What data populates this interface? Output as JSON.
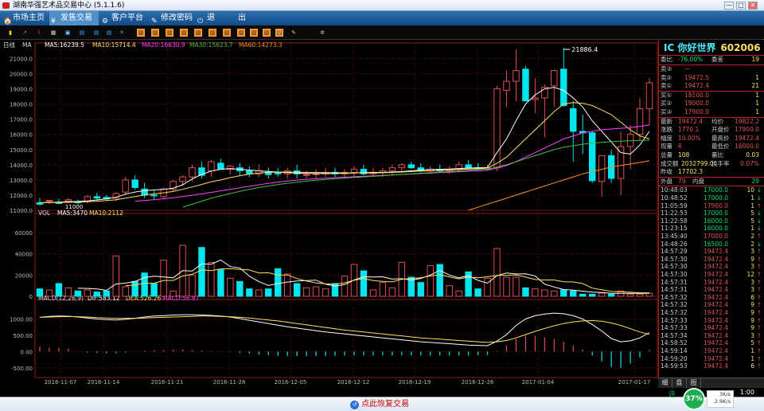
{
  "window": {
    "title": "湖南华强艺术品交易中心 (5.1.1.6)",
    "min": "—",
    "max": "□",
    "close": "✕"
  },
  "menu": [
    {
      "label": "市场主页",
      "icon": "🏠"
    },
    {
      "label": "发售交易",
      "icon": "¥"
    },
    {
      "label": "客户平台",
      "icon": "⚙"
    },
    {
      "label": "修改密码",
      "icon": "✎"
    },
    {
      "label": "退",
      "icon": "⏻"
    },
    {
      "label": "出",
      "icon": ""
    }
  ],
  "toolbar_icons": [
    "bar-chart",
    "line-chart",
    "k-line",
    "grid",
    "window",
    "doc-1",
    "doc-2",
    "doc-3",
    "close-doc",
    "layout-1",
    "layout-2",
    "layout-3",
    "layout-4",
    "layout-5",
    "layout-6",
    "layout-7",
    "layout-8",
    "layout-9",
    "layout-10",
    "layout-11",
    "search",
    "pen",
    "settings"
  ],
  "colors": {
    "up": "#e05050",
    "down": "#00e5ee",
    "ma5": "#ffffff",
    "ma10": "#ffe060",
    "ma20": "#ff40ff",
    "ma30": "#40c040",
    "ma60": "#ff9020",
    "volbar_up": "#e05050",
    "volbar_down": "#00e5ee",
    "accent": "#4ef0ff"
  },
  "kline": {
    "header": {
      "period": "日线",
      "adj": "MA",
      "ma5": "MA5:16239.5",
      "ma10": "MA10:15714.4",
      "ma20": "MA20:16630.9",
      "ma30": "MA30:15623.7",
      "ma60": "MA60:14273.3"
    },
    "ylim": [
      11000,
      21600
    ],
    "yticks": [
      "21000.0",
      "20000.0",
      "19000.0",
      "18000.0",
      "17000.0",
      "16000.0",
      "15000.0",
      "14000.0",
      "13000.0",
      "12000.0",
      "11000.0"
    ],
    "ytick_values": [
      21000,
      20000,
      19000,
      18000,
      17000,
      16000,
      15000,
      14000,
      13000,
      12000,
      11000
    ],
    "peak_label": "21886.4",
    "low_label": "11000"
  },
  "volume": {
    "header": {
      "name": "VOL",
      "ma5": "MA5:3470",
      "ma10": "MA10:2112"
    },
    "ylim": [
      0,
      75000
    ],
    "yticks": [
      "60000",
      "40000",
      "20000",
      "0"
    ],
    "ytick_values": [
      60000,
      40000,
      20000,
      0
    ]
  },
  "macd": {
    "header": {
      "name": "MACD(12,26,9)",
      "dif": "DIF:583.12",
      "dea": "DEA:526.26",
      "macd": "MACD:56.87"
    },
    "ylim": [
      -700,
      1500
    ],
    "yticks": [
      "1000.00",
      "500.00",
      "0.00",
      "-500.00"
    ],
    "ytick_values": [
      1000,
      500,
      0,
      -500
    ]
  },
  "xaxis": {
    "labels": [
      "2016-11-07",
      "2016-11-14",
      "2016-11-21",
      "2016-11-28",
      "2016-12-05",
      "2016-12-12",
      "2016-12-19",
      "2016-12-26",
      "2017-01-04",
      "2017-01-17"
    ]
  },
  "chart_data": {
    "type": "candlestick",
    "candles": [
      [
        11500,
        11800,
        11300,
        11400
      ],
      [
        11600,
        11700,
        11400,
        11650
      ],
      [
        11500,
        11750,
        11400,
        11450
      ],
      [
        11600,
        11800,
        11450,
        11700
      ],
      [
        11550,
        11700,
        11400,
        11500
      ],
      [
        11600,
        12000,
        11450,
        11900
      ],
      [
        11900,
        12150,
        11700,
        11800
      ],
      [
        11850,
        12000,
        11650,
        11750
      ],
      [
        11800,
        12200,
        11600,
        12100
      ],
      [
        12200,
        13200,
        12000,
        13000
      ],
      [
        13000,
        13300,
        12350,
        12500
      ],
      [
        12400,
        12800,
        11800,
        12000
      ],
      [
        12000,
        12300,
        11700,
        11950
      ],
      [
        11900,
        12500,
        11800,
        12400
      ],
      [
        12400,
        13000,
        12200,
        12900
      ],
      [
        12900,
        13300,
        12600,
        13200
      ],
      [
        13200,
        14000,
        12900,
        13800
      ],
      [
        13800,
        14200,
        13100,
        13300
      ],
      [
        13600,
        14300,
        13200,
        14200
      ],
      [
        14100,
        14400,
        13700,
        13700
      ],
      [
        13700,
        14000,
        13400,
        13900
      ],
      [
        13800,
        14100,
        13300,
        13600
      ],
      [
        13600,
        13900,
        13200,
        13400
      ],
      [
        13400,
        14000,
        13200,
        13600
      ],
      [
        13500,
        13800,
        13100,
        13350
      ],
      [
        13500,
        13800,
        13200,
        13400
      ],
      [
        13400,
        13800,
        13100,
        13600
      ],
      [
        13600,
        14000,
        13100,
        13400
      ],
      [
        13300,
        13600,
        13100,
        13350
      ],
      [
        13400,
        13700,
        13100,
        13400
      ],
      [
        13400,
        13800,
        13200,
        13500
      ],
      [
        13500,
        13800,
        13200,
        13400
      ],
      [
        13400,
        13700,
        13100,
        13500
      ],
      [
        13500,
        13900,
        13200,
        13700
      ],
      [
        13700,
        14000,
        13300,
        13400
      ],
      [
        13400,
        13800,
        13200,
        13500
      ],
      [
        13500,
        13800,
        13200,
        13600
      ],
      [
        13600,
        14000,
        13300,
        13800
      ],
      [
        13800,
        14100,
        13500,
        14000
      ],
      [
        14000,
        14200,
        13700,
        13800
      ],
      [
        13800,
        14100,
        13500,
        13600
      ],
      [
        13600,
        13900,
        13400,
        13700
      ],
      [
        13700,
        14000,
        13500,
        13600
      ],
      [
        13600,
        13900,
        13400,
        13700
      ],
      [
        13700,
        14200,
        13500,
        14000
      ],
      [
        14000,
        14300,
        13700,
        13800
      ],
      [
        13800,
        14100,
        13600,
        13700
      ],
      [
        13700,
        14000,
        13600,
        13800
      ],
      [
        13800,
        19200,
        13600,
        19000
      ],
      [
        18900,
        20200,
        17800,
        19500
      ],
      [
        19500,
        21600,
        18200,
        20200
      ],
      [
        20300,
        20500,
        18200,
        18200
      ],
      [
        18300,
        19700,
        17400,
        18400
      ],
      [
        18400,
        19300,
        15800,
        19100
      ],
      [
        19200,
        20300,
        17800,
        20200
      ],
      [
        20300,
        21700,
        17800,
        17900
      ],
      [
        17700,
        18200,
        14200,
        16200
      ],
      [
        16200,
        17300,
        14700,
        16100
      ],
      [
        16100,
        16200,
        12800,
        12950
      ],
      [
        12900,
        13300,
        11900,
        14600
      ],
      [
        14600,
        15000,
        12800,
        13100
      ],
      [
        13100,
        16200,
        12000,
        15200
      ],
      [
        15200,
        16600,
        13700,
        16000
      ],
      [
        16000,
        18400,
        15600,
        17700
      ],
      [
        17700,
        19700,
        16600,
        19400
      ]
    ],
    "ma5": [
      11500,
      11520,
      11540,
      11560,
      11580,
      11620,
      11680,
      11760,
      11860,
      12060,
      12200,
      12300,
      12340,
      12380,
      12460,
      12680,
      13060,
      13360,
      13580,
      13700,
      13750,
      13700,
      13650,
      13600,
      13560,
      13520,
      13480,
      13450,
      13430,
      13420,
      13420,
      13430,
      13440,
      13460,
      13480,
      13490,
      13500,
      13520,
      13550,
      13600,
      13650,
      13680,
      13700,
      13720,
      13750,
      13780,
      13800,
      13820,
      14800,
      15700,
      16900,
      18000,
      18600,
      19000,
      19100,
      18900,
      18400,
      17800,
      16900,
      16200,
      15500,
      14800,
      14700,
      15300,
      16200
    ],
    "ma10": [
      11500,
      11510,
      11520,
      11530,
      11540,
      11560,
      11600,
      11640,
      11700,
      11800,
      11900,
      12000,
      12080,
      12150,
      12250,
      12380,
      12540,
      12700,
      12880,
      13000,
      13150,
      13280,
      13380,
      13450,
      13500,
      13520,
      13520,
      13510,
      13500,
      13490,
      13480,
      13470,
      13460,
      13460,
      13460,
      13460,
      13470,
      13490,
      13520,
      13550,
      13580,
      13600,
      13630,
      13660,
      13690,
      13720,
      13750,
      13780,
      14100,
      14500,
      15100,
      15700,
      16300,
      16900,
      17500,
      18000,
      18100,
      18050,
      17900,
      17600,
      17300,
      16800,
      16300,
      15900,
      15700
    ],
    "ma20": [
      null,
      null,
      null,
      null,
      null,
      null,
      null,
      null,
      null,
      null,
      11600,
      11650,
      11700,
      11760,
      11830,
      11900,
      11990,
      12080,
      12180,
      12280,
      12380,
      12480,
      12580,
      12680,
      12780,
      12860,
      12930,
      12990,
      13040,
      13080,
      13120,
      13150,
      13180,
      13210,
      13240,
      13270,
      13300,
      13330,
      13360,
      13390,
      13420,
      13450,
      13480,
      13510,
      13540,
      13570,
      13600,
      13640,
      13780,
      13950,
      14200,
      14500,
      14800,
      15100,
      15400,
      15700,
      15900,
      16100,
      16200,
      16300,
      16350,
      16400,
      16450,
      16520,
      16630
    ],
    "ma30": [
      null,
      null,
      null,
      null,
      null,
      null,
      null,
      null,
      null,
      null,
      null,
      null,
      null,
      null,
      null,
      11200,
      11400,
      11600,
      11800,
      11950,
      12100,
      12250,
      12380,
      12500,
      12600,
      12700,
      12780,
      12850,
      12920,
      12980,
      13030,
      13080,
      13120,
      13160,
      13200,
      13240,
      13280,
      13320,
      13360,
      13400,
      13440,
      13480,
      13520,
      13560,
      13600,
      13640,
      13680,
      13720,
      13850,
      14000,
      14200,
      14400,
      14600,
      14800,
      15000,
      15150,
      15250,
      15350,
      15420,
      15480,
      15520,
      15560,
      15580,
      15600,
      15620
    ],
    "ma60": [
      null,
      null,
      null,
      null,
      null,
      null,
      null,
      null,
      null,
      null,
      null,
      null,
      null,
      null,
      null,
      null,
      null,
      null,
      null,
      null,
      null,
      null,
      null,
      null,
      null,
      null,
      null,
      null,
      null,
      null,
      null,
      null,
      null,
      null,
      null,
      null,
      null,
      null,
      null,
      null,
      null,
      null,
      null,
      null,
      null,
      11000,
      11200,
      11400,
      11600,
      11800,
      12000,
      12200,
      12400,
      12600,
      12800,
      13000,
      13200,
      13400,
      13550,
      13700,
      13850,
      13950,
      14050,
      14150,
      14270
    ],
    "volume": [
      7000,
      6000,
      12000,
      8000,
      5000,
      6000,
      4000,
      5000,
      38000,
      9000,
      14000,
      22000,
      12000,
      34000,
      5000,
      48000,
      20000,
      46000,
      32000,
      25000,
      17000,
      14000,
      7000,
      6000,
      7000,
      26000,
      21000,
      12000,
      8000,
      9000,
      7000,
      12000,
      19000,
      30000,
      24000,
      6000,
      13000,
      8000,
      32000,
      18000,
      13000,
      29000,
      30000,
      10000,
      5000,
      23000,
      7000,
      17000,
      45000,
      18000,
      18000,
      8000,
      7000,
      6000,
      5000,
      6000,
      5000,
      2000,
      2000,
      3000,
      2000,
      5000,
      2000,
      2000,
      3000
    ],
    "dif": [
      1050,
      1080,
      1090,
      1085,
      1060,
      1030,
      1000,
      980,
      970,
      990,
      1020,
      1060,
      1090,
      1100,
      1120,
      1130,
      1130,
      1120,
      1110,
      1090,
      1060,
      1010,
      960,
      910,
      860,
      810,
      760,
      720,
      680,
      640,
      600,
      570,
      540,
      510,
      480,
      450,
      420,
      390,
      360,
      330,
      300,
      280,
      260,
      240,
      220,
      200,
      190,
      180,
      320,
      520,
      800,
      1000,
      1100,
      1150,
      1180,
      1160,
      1100,
      1000,
      830,
      630,
      400,
      300,
      330,
      420,
      583
    ],
    "dea": [
      1050,
      1060,
      1070,
      1075,
      1070,
      1060,
      1040,
      1030,
      1020,
      1020,
      1020,
      1030,
      1040,
      1050,
      1060,
      1070,
      1080,
      1090,
      1090,
      1080,
      1070,
      1050,
      1030,
      1000,
      970,
      940,
      900,
      860,
      820,
      780,
      740,
      700,
      660,
      630,
      600,
      570,
      540,
      510,
      480,
      450,
      420,
      400,
      380,
      360,
      340,
      320,
      300,
      280,
      300,
      340,
      420,
      520,
      620,
      710,
      790,
      860,
      910,
      940,
      950,
      930,
      880,
      800,
      700,
      600,
      526
    ],
    "macd": [
      150,
      120,
      110,
      95,
      0,
      -30,
      -40,
      -50,
      -50,
      -30,
      0,
      30,
      50,
      50,
      60,
      60,
      50,
      30,
      20,
      10,
      -10,
      -40,
      -70,
      -90,
      -110,
      -130,
      -140,
      -140,
      -140,
      -140,
      -140,
      -130,
      -120,
      -120,
      -120,
      -120,
      -120,
      -120,
      -120,
      -120,
      -120,
      -120,
      -120,
      -120,
      -120,
      -120,
      -110,
      -100,
      20,
      180,
      380,
      480,
      480,
      440,
      390,
      300,
      190,
      60,
      -120,
      -300,
      -480,
      -500,
      -370,
      -180,
      57
    ]
  },
  "quote": {
    "code": "IC 你好世界",
    "id": "602006",
    "ratio": {
      "label": "委比",
      "value": "-76.00%",
      "label2": "委差",
      "value2": "19"
    },
    "sell": [
      {
        "label": "卖③",
        "price": "—",
        "qty": ""
      },
      {
        "label": "卖②",
        "price": "19472.5",
        "qty": "1"
      },
      {
        "label": "卖①",
        "price": "19472.4",
        "qty": "21"
      }
    ],
    "buy": [
      {
        "label": "买①",
        "price": "18100.0",
        "qty": "1"
      },
      {
        "label": "买②",
        "price": "18000.0",
        "qty": "1"
      },
      {
        "label": "买③",
        "price": "17900.0",
        "qty": "1"
      }
    ],
    "stats": [
      {
        "l1": "最新",
        "v1": "19472.4",
        "l2": "均价",
        "v2": "19822.2"
      },
      {
        "l1": "涨跌",
        "v1": "1770.1",
        "l2": "开盘价",
        "v2": "17900.0"
      },
      {
        "l1": "幅度",
        "v1": "10.00%",
        "l2": "最高价",
        "v2": "19472.4"
      },
      {
        "l1": "现量",
        "v1": "6",
        "l2": "最低价",
        "v2": "16000.0"
      },
      {
        "l1": "总量",
        "v1": "108",
        "l2": "量比",
        "v2": "0.03"
      },
      {
        "l1": "成交额",
        "v1": "2032799.0",
        "l2": "换手率",
        "v2": "0.07%"
      },
      {
        "l1": "昨收",
        "v1": "17702.3",
        "l2": "",
        "v2": ""
      }
    ],
    "outer": {
      "label": "外盘",
      "value": "79",
      "label2": "内盘",
      "value2": "29"
    },
    "ticks": [
      {
        "t": "10:48:03",
        "p": "17000.0",
        "q": "10",
        "d": "↓",
        "c": "down"
      },
      {
        "t": "10:48:52",
        "p": "17000.0",
        "q": "1",
        "d": "↓",
        "c": "down"
      },
      {
        "t": "11:05:59",
        "p": "17900.0",
        "q": "1",
        "d": "↑",
        "c": "up"
      },
      {
        "t": "11:22:53",
        "p": "17000.0",
        "q": "5",
        "d": "↓",
        "c": "down"
      },
      {
        "t": "11:22:58",
        "p": "16000.0",
        "q": "5",
        "d": "↓",
        "c": "down"
      },
      {
        "t": "11:23:15",
        "p": "16000.0",
        "q": "1",
        "d": "↓",
        "c": "down"
      },
      {
        "t": "13:45:40",
        "p": "17000.0",
        "q": "2",
        "d": "↑",
        "c": "up"
      },
      {
        "t": "14:48:26",
        "p": "16500.0",
        "q": "2",
        "d": "↓",
        "c": "down"
      },
      {
        "t": "14:57:29",
        "p": "19472.4",
        "q": "3",
        "d": "↑",
        "c": "up"
      },
      {
        "t": "14:57:30",
        "p": "19472.4",
        "q": "9",
        "d": "↑",
        "c": "up"
      },
      {
        "t": "14:57:30",
        "p": "19472.4",
        "q": "3",
        "d": "↑",
        "c": "up"
      },
      {
        "t": "14:57:30",
        "p": "19472.4",
        "q": "12",
        "d": "↑",
        "c": "up"
      },
      {
        "t": "14:57:31",
        "p": "19472.4",
        "q": "3",
        "d": "↑",
        "c": "up"
      },
      {
        "t": "14:57:31",
        "p": "19472.4",
        "q": "3",
        "d": "↑",
        "c": "up"
      },
      {
        "t": "14:57:32",
        "p": "19472.4",
        "q": "6",
        "d": "↑",
        "c": "up"
      },
      {
        "t": "14:57:32",
        "p": "19472.4",
        "q": "9",
        "d": "↑",
        "c": "up"
      },
      {
        "t": "14:57:32",
        "p": "19472.4",
        "q": "9",
        "d": "↑",
        "c": "up"
      },
      {
        "t": "14:57:33",
        "p": "19472.4",
        "q": "9",
        "d": "↑",
        "c": "up"
      },
      {
        "t": "14:57:33",
        "p": "19472.4",
        "q": "9",
        "d": "↑",
        "c": "up"
      },
      {
        "t": "14:57:34",
        "p": "19472.4",
        "q": "3",
        "d": "↑",
        "c": "up"
      },
      {
        "t": "14:58:52",
        "p": "19472.4",
        "q": "5",
        "d": "↑",
        "c": "up"
      },
      {
        "t": "14:59:14",
        "p": "19472.4",
        "q": "1",
        "d": "↑",
        "c": "up"
      },
      {
        "t": "14:59:20",
        "p": "19472.4",
        "q": "1",
        "d": "↑",
        "c": "up"
      },
      {
        "t": "14:59:53",
        "p": "19472.4",
        "q": "6",
        "d": "↑",
        "c": "up"
      }
    ],
    "tabs": [
      "细",
      "盘",
      "图"
    ]
  },
  "status": {
    "restore": "点此恢复交易",
    "conn": "连",
    "gauge": "37%",
    "speed_up": "3K/s",
    "speed_down": "2.9K/s",
    "clock": "1:00"
  }
}
